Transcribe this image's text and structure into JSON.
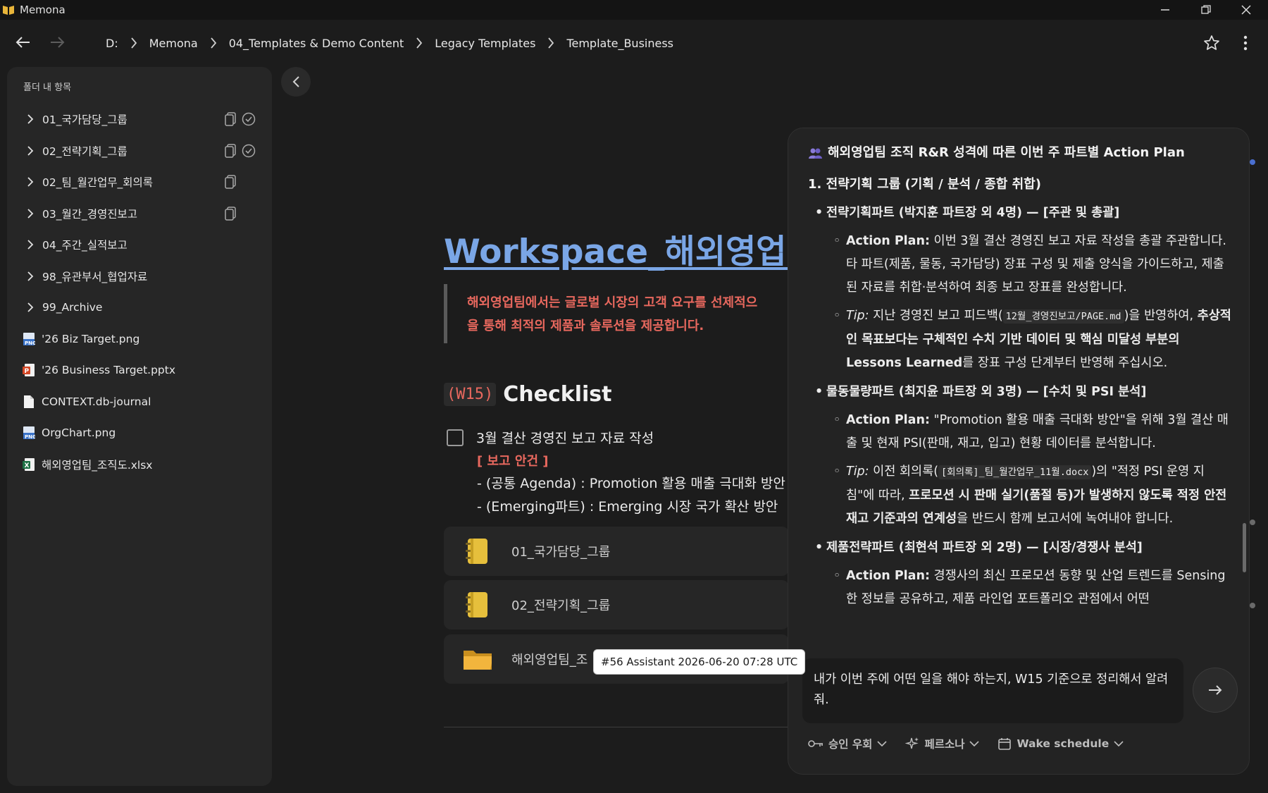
{
  "app": {
    "title": "Memona"
  },
  "breadcrumbs": [
    "D:",
    "Memona",
    "04_Templates & Demo Content",
    "Legacy Templates",
    "Template_Business"
  ],
  "sidebar": {
    "header": "폴더 내 항목",
    "folders": [
      {
        "label": "01_국가담당_그룹",
        "copy_icon": true,
        "check_icon": true
      },
      {
        "label": "02_전략기획_그룹",
        "copy_icon": true,
        "check_icon": true
      },
      {
        "label": "02_팀_월간업무_회의록",
        "copy_icon": true,
        "check_icon": false
      },
      {
        "label": "03_월간_경영진보고",
        "copy_icon": true,
        "check_icon": false
      },
      {
        "label": "04_주간_실적보고",
        "copy_icon": false,
        "check_icon": false
      },
      {
        "label": "98_유관부서_협업자료",
        "copy_icon": false,
        "check_icon": false
      },
      {
        "label": "99_Archive",
        "copy_icon": false,
        "check_icon": false
      }
    ],
    "files": [
      {
        "label": "'26 Biz Target.png",
        "icon": "png-file-icon"
      },
      {
        "label": "'26 Business Target.pptx",
        "icon": "pptx-file-icon"
      },
      {
        "label": "CONTEXT.db-journal",
        "icon": "document-icon"
      },
      {
        "label": "OrgChart.png",
        "icon": "png-file-icon"
      },
      {
        "label": "해외영업팀_조직도.xlsx",
        "icon": "xlsx-file-icon"
      }
    ]
  },
  "document": {
    "title": "Workspace_해외영업팀",
    "quote_line1": "해외영업팀에서는 글로벌 시장의 고객 요구를 선제적으",
    "quote_line2": "을 통해 최적의 제품과 솔루션을 제공합니다.",
    "checklist_tag": "(W15)",
    "checklist_title": "Checklist",
    "checklist_item": "3월 결산 경영진 보고 자료 작성",
    "report_label": "[ 보고 안건 ]",
    "agenda_1": "- (공통 Agenda) : Promotion 활용 매출 극대화 방안",
    "agenda_2": "- (Emerging파트) : Emerging 시장 국가 확산 방안",
    "cards": [
      {
        "label": "01_국가담당_그룹",
        "icon": "notebook-icon"
      },
      {
        "label": "02_전략기획_그룹",
        "icon": "notebook-icon"
      },
      {
        "label": "해외영업팀_조",
        "icon": "folder-icon"
      }
    ]
  },
  "tooltip": "#56 Assistant 2026-06-20 07:28 UTC",
  "chat": {
    "heading": "해외영업팀 조직 R&R 성격에 따른 이번 주 파트별 Action Plan",
    "section1": "1. 전략기획 그룹 (기획 / 분석 / 종합 취합)",
    "part1_title": "전략기획파트 (박지훈 파트장 외 4명) — [주관 및 총괄]",
    "part1_action_label": "Action Plan:",
    "part1_action_text": " 이번 3월 결산 경영진 보고 자료 작성을 총괄 주관합니다. 타 파트(제품, 물동, 국가담당) 장표 구성 및 제출 양식을 가이드하고, 제출된 자료를 취합·분석하여 최종 보고 장표를 완성합니다.",
    "part1_tip_label": "Tip:",
    "part1_tip_pre": " 지난 경영진 보고 피드백(",
    "part1_tip_code": "12월_경영진보고/PAGE.md",
    "part1_tip_mid": ")을 반영하여, ",
    "part1_tip_bold": "추상적인 목표보다는 구체적인 수치 기반 데이터 및 핵심 미달성 부분의 Lessons Learned",
    "part1_tip_post": "를 장표 구성 단계부터 반영해 주십시오.",
    "part2_title": "물동물량파트 (최지윤 파트장 외 3명) — [수치 및 PSI 분석]",
    "part2_action_label": "Action Plan:",
    "part2_action_text": " \"Promotion 활용 매출 극대화 방안\"을 위해 3월 결산 매출 및 현재 PSI(판매, 재고, 입고) 현황 데이터를 분석합니다.",
    "part2_tip_label": "Tip:",
    "part2_tip_pre": " 이전 회의록(",
    "part2_tip_code": "[회의록]_팀_월간업무_11월.docx",
    "part2_tip_mid": ")의 \"적정 PSI 운영 지침\"에 따라, ",
    "part2_tip_bold": "프로모션 시 판매 실기(품절 등)가 발생하지 않도록 적정 안전 재고 기준과의 연계성",
    "part2_tip_post": "을 반드시 함께 보고서에 녹여내야 합니다.",
    "part3_title": "제품전략파트 (최현석 파트장 외 2명) — [시장/경쟁사 분석]",
    "part3_action_label": "Action Plan:",
    "part3_action_text": " 경쟁사의 최신 프로모션 동향 및 산업 트렌드를 Sensing한 정보를 공유하고, 제품 라인업 포트폴리오 관점에서 어떤",
    "input_text": "내가 이번 주에 어떤 일을 해야 하는지, W15 기준으로 정리해서 알려 줘.",
    "toolbar": {
      "approval": "승인 우회",
      "persona": "페르소나",
      "schedule": "Wake schedule"
    }
  },
  "colors": {
    "accent_link": "#7aa6e6",
    "accent_red": "#e8685e",
    "background": "#1c1c1c",
    "panel": "#232323"
  }
}
